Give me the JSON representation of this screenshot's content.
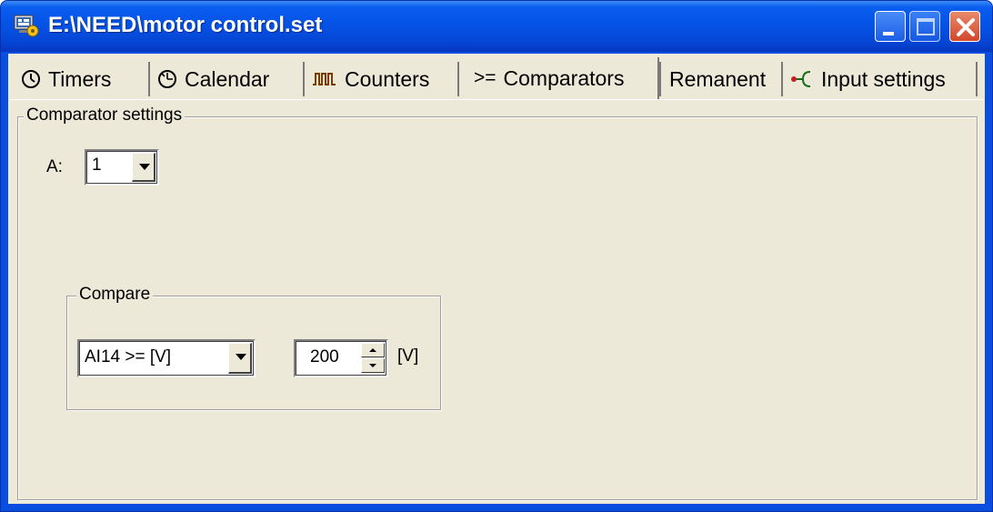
{
  "window": {
    "title": "E:\\NEED\\motor control.set",
    "title_bar_color": "#0a4ee0",
    "icons": {
      "app": "app-icon",
      "minimize": "minimize-icon",
      "maximize": "maximize-icon",
      "close": "close-icon"
    }
  },
  "tabs": [
    {
      "label": "Timers",
      "icon": "clock-icon",
      "active": false
    },
    {
      "label": "Calendar",
      "icon": "calendar-clock-icon",
      "active": false
    },
    {
      "label": "Counters",
      "icon": "counter-pulse-icon",
      "active": false
    },
    {
      "label": "Comparators",
      "icon_text": ">=",
      "active": true
    },
    {
      "label": "Remanent",
      "active": false
    },
    {
      "label": "Input settings",
      "icon": "input-branch-icon",
      "active": false
    }
  ],
  "comparator_settings": {
    "legend": "Comparator settings",
    "a_label": "A:",
    "a_value": "1",
    "compare": {
      "legend": "Compare",
      "operator_value": "AI14 >= [V]",
      "threshold_value": "200",
      "unit": "[V]"
    }
  },
  "colors": {
    "panel_bg": "#ece9d8",
    "close_button": "#d2472a"
  }
}
